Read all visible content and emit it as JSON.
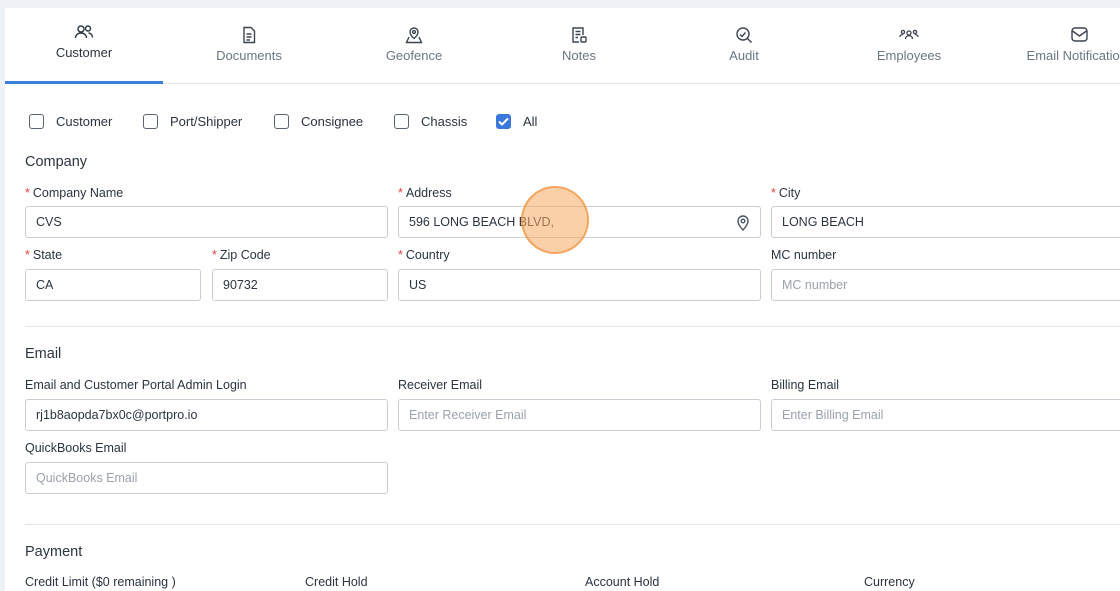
{
  "tabs": [
    {
      "label": "Customer",
      "icon": "users-icon",
      "active": true
    },
    {
      "label": "Documents",
      "icon": "document-icon"
    },
    {
      "label": "Geofence",
      "icon": "geofence-icon"
    },
    {
      "label": "Notes",
      "icon": "notes-icon"
    },
    {
      "label": "Audit",
      "icon": "audit-icon"
    },
    {
      "label": "Employees",
      "icon": "employees-icon"
    },
    {
      "label": "Email Notifications",
      "icon": "email-notification-icon"
    }
  ],
  "filters": [
    {
      "label": "Customer",
      "checked": false
    },
    {
      "label": "Port/Shipper",
      "checked": false
    },
    {
      "label": "Consignee",
      "checked": false
    },
    {
      "label": "Chassis",
      "checked": false
    },
    {
      "label": "All",
      "checked": true
    }
  ],
  "company": {
    "title": "Company",
    "required_mark": "*",
    "company_name_label": "Company Name",
    "company_name_value": "CVS",
    "address_label": "Address",
    "address_value": "596 LONG BEACH BLVD,",
    "city_label": "City",
    "city_value": "LONG BEACH",
    "state_label": "State",
    "state_value": "CA",
    "zip_label": "Zip Code",
    "zip_value": "90732",
    "country_label": "Country",
    "country_value": "US",
    "mc_label": "MC number",
    "mc_placeholder": "MC number"
  },
  "email": {
    "title": "Email",
    "admin_label": "Email and Customer Portal Admin Login",
    "admin_value": "rj1b8aopda7bx0c@portpro.io",
    "receiver_label": "Receiver Email",
    "receiver_placeholder": "Enter Receiver Email",
    "billing_label": "Billing Email",
    "billing_placeholder": "Enter Billing Email",
    "quickbooks_label": "QuickBooks Email",
    "quickbooks_placeholder": "QuickBooks Email"
  },
  "payment": {
    "title": "Payment",
    "credit_limit_label": "Credit Limit ($0 remaining )",
    "credit_hold_label": "Credit Hold",
    "account_hold_label": "Account Hold",
    "currency_label": "Currency"
  },
  "colors": {
    "accent": "#3f7fd9",
    "required": "#e0443e",
    "checkbox": "#3b78dc"
  }
}
